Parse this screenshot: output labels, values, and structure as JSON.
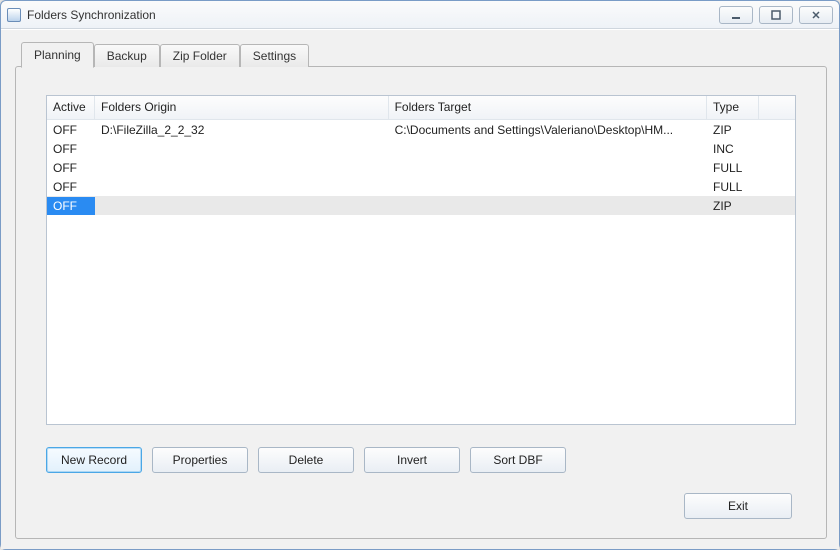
{
  "window": {
    "title": "Folders Synchronization"
  },
  "tabs": [
    {
      "label": "Planning"
    },
    {
      "label": "Backup"
    },
    {
      "label": "Zip Folder"
    },
    {
      "label": "Settings"
    }
  ],
  "active_tab_index": 0,
  "columns": {
    "active": "Active",
    "origin": "Folders Origin",
    "target": "Folders Target",
    "type": "Type"
  },
  "rows": [
    {
      "active": "OFF",
      "origin": "D:\\FileZilla_2_2_32",
      "target": "C:\\Documents and Settings\\Valeriano\\Desktop\\HM...",
      "type": "ZIP",
      "selected": false
    },
    {
      "active": "OFF",
      "origin": "",
      "target": "",
      "type": "INC",
      "selected": false
    },
    {
      "active": "OFF",
      "origin": "",
      "target": "",
      "type": "FULL",
      "selected": false
    },
    {
      "active": "OFF",
      "origin": "",
      "target": "",
      "type": "FULL",
      "selected": false
    },
    {
      "active": "OFF",
      "origin": "",
      "target": "",
      "type": "ZIP",
      "selected": true
    }
  ],
  "buttons": {
    "new_record": "New Record",
    "properties": "Properties",
    "delete": "Delete",
    "invert": "Invert",
    "sort_dbf": "Sort DBF",
    "exit": "Exit"
  }
}
